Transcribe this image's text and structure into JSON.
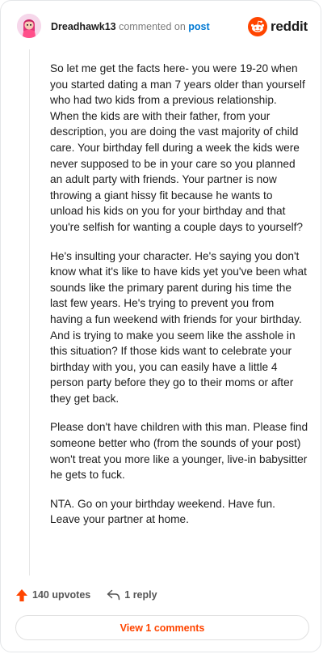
{
  "header": {
    "username": "Dreadhawk13",
    "action": "commented on",
    "post_link": "post",
    "brand": "reddit"
  },
  "comment": {
    "paragraphs": [
      "So let me get the facts here- you were 19-20 when you started dating a man 7 years older than yourself who had two kids from a previous relationship. When the kids are with their father, from your description, you are doing the vast majority of child care. Your birthday fell during a week the kids were never supposed to be in your care so you planned an adult party with friends. Your partner is now throwing a giant hissy fit because he wants to unload his kids on you for your birthday and that you're selfish for wanting a couple days to yourself?",
      "He's insulting your character. He's saying you don't know what it's like to have kids yet you've been what sounds like the primary parent during his time the last few years. He's trying to prevent you from having a fun weekend with friends for your birthday. And is trying to make you seem like the asshole in this situation? If those kids want to celebrate your birthday with you, you can easily have a little 4 person party before they go to their moms or after they get back.",
      "Please don't have children with this man. Please find someone better who (from the sounds of your post) won't treat you more like a younger, live-in babysitter he gets to fuck.",
      "NTA. Go on your birthday weekend. Have fun. Leave your partner at home."
    ]
  },
  "actions": {
    "upvotes_label": "140 upvotes",
    "reply_label": "1 reply",
    "view_comments_label": "View 1 comments"
  },
  "colors": {
    "brand_orange": "#ff4500",
    "link_blue": "#0079d3"
  },
  "icons": {
    "upvote": "upvote-arrow-icon",
    "reply": "reply-arrow-icon",
    "brand": "reddit-snoo-icon",
    "avatar": "user-avatar"
  }
}
